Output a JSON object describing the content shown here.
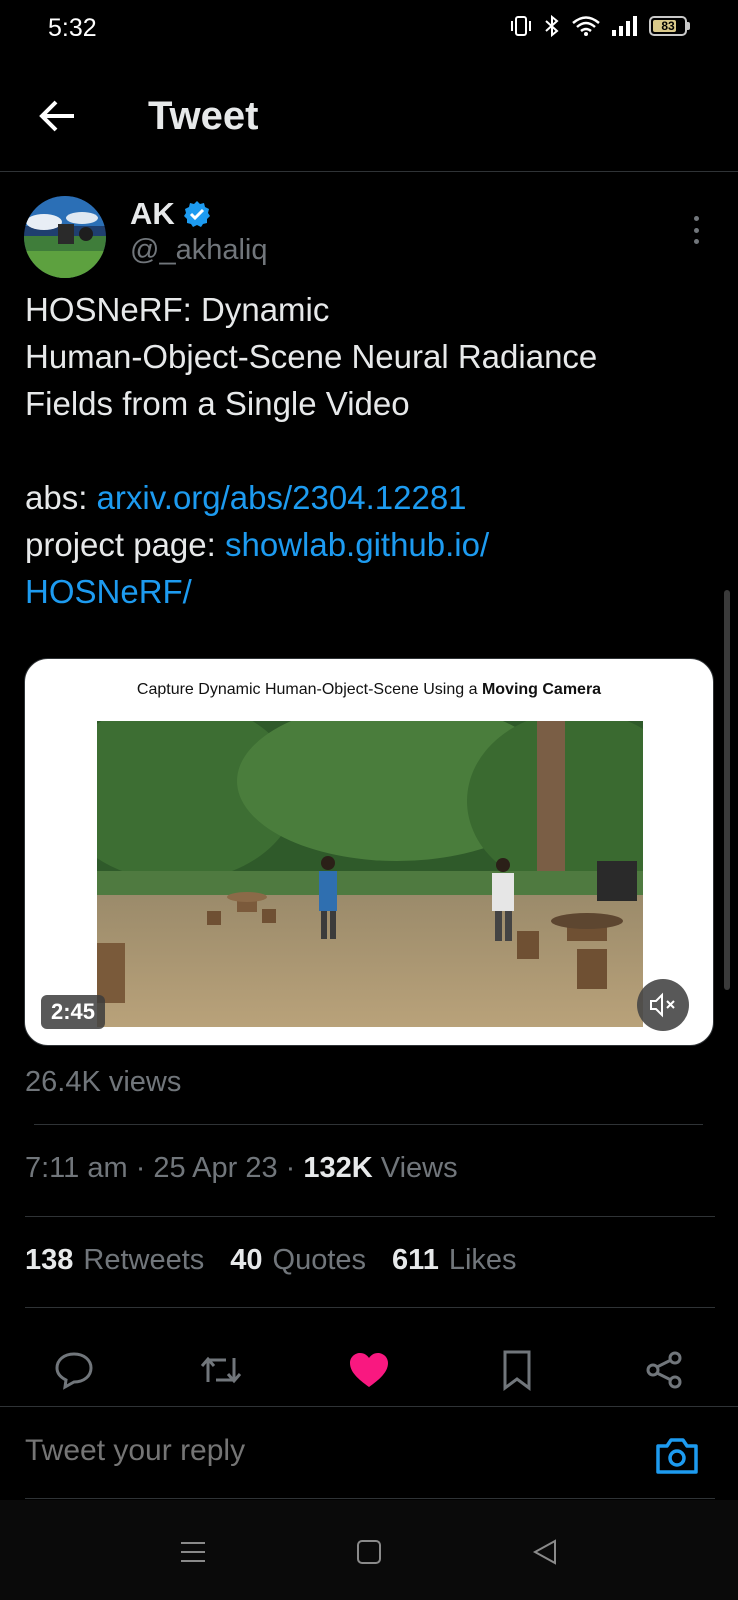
{
  "status": {
    "time": "5:32",
    "battery": "83"
  },
  "header": {
    "title": "Tweet"
  },
  "author": {
    "name": "AK",
    "handle": "@_akhaliq"
  },
  "tweet": {
    "line1": "HOSNeRF: Dynamic",
    "line2": "Human-Object-Scene Neural Radiance",
    "line3": "Fields from a Single Video",
    "abs_label": "abs: ",
    "abs_link": "arxiv.org/abs/2304.12281",
    "project_label": "project page: ",
    "project_link_1": "showlab.github.io/",
    "project_link_2": "HOSNeRF/"
  },
  "media": {
    "caption_prefix": "Capture Dynamic Human-Object-Scene Using a ",
    "caption_bold": "Moving Camera",
    "duration": "2:45"
  },
  "video_views": "26.4K views",
  "meta": {
    "time": "7:11 am",
    "sep1": " · ",
    "date": "25 Apr 23",
    "sep2": " · ",
    "views_count": "132K",
    "views_label": " Views"
  },
  "stats": {
    "retweets_count": "138",
    "retweets_label": "Retweets",
    "quotes_count": "40",
    "quotes_label": "Quotes",
    "likes_count": "611",
    "likes_label": "Likes"
  },
  "actions": [
    "reply-icon",
    "retweet-icon",
    "heart-icon",
    "bookmark-icon",
    "share-icon"
  ],
  "colors": {
    "accent": "#1d9bf0",
    "like": "#f91880",
    "muted": "#71767b"
  },
  "reply": {
    "placeholder": "Tweet your reply"
  }
}
